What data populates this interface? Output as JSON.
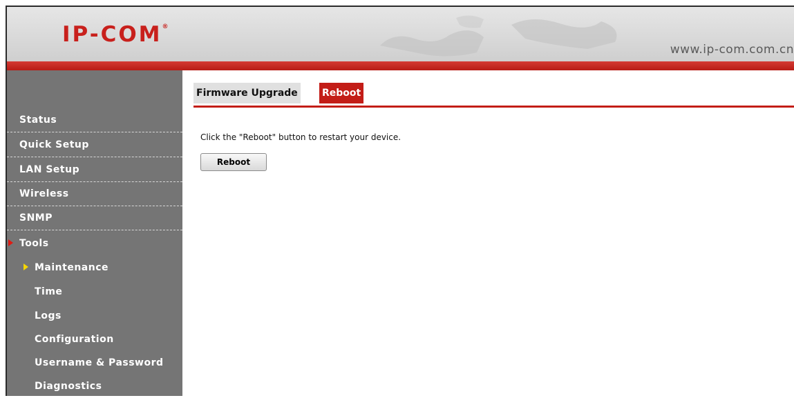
{
  "header": {
    "logo_text": "IP-COM",
    "logo_mark": "®",
    "url": "www.ip-com.com.cn",
    "brand_color": "#c8201c"
  },
  "sidebar": {
    "items": [
      {
        "label": "Status",
        "level": 1
      },
      {
        "label": "Quick Setup",
        "level": 1
      },
      {
        "label": "LAN Setup",
        "level": 1
      },
      {
        "label": "Wireless",
        "level": 1
      },
      {
        "label": "SNMP",
        "level": 1
      },
      {
        "label": "Tools",
        "level": 1,
        "active": true
      },
      {
        "label": "Maintenance",
        "level": 2,
        "active": true
      },
      {
        "label": "Time",
        "level": 2
      },
      {
        "label": "Logs",
        "level": 2
      },
      {
        "label": "Configuration",
        "level": 2
      },
      {
        "label": "Username & Password",
        "level": 2
      },
      {
        "label": "Diagnostics",
        "level": 2
      }
    ],
    "bg_color": "#757575"
  },
  "tabs": [
    {
      "label": "Firmware Upgrade",
      "active": false
    },
    {
      "label": "Reboot",
      "active": true
    }
  ],
  "main": {
    "description": "Click the \"Reboot\" button to restart your device.",
    "button_label": "Reboot"
  }
}
